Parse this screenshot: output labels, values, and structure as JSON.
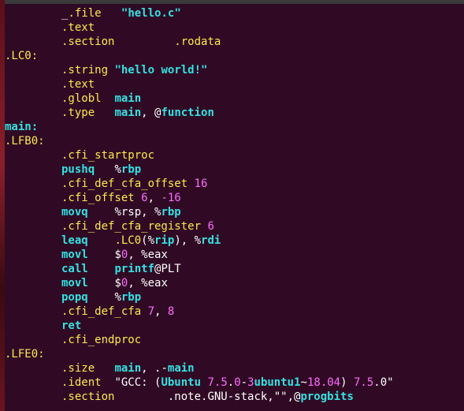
{
  "editor": {
    "lines": [
      {
        "indent": true,
        "parts": [
          {
            "text": "_",
            "c": "white"
          },
          {
            "text": ".file",
            "c": "yel"
          },
          {
            "text": "   ",
            "c": "white"
          },
          {
            "text": "\"hello.c\"",
            "c": "str"
          }
        ]
      },
      {
        "indent": true,
        "parts": [
          {
            "text": ".text",
            "c": "yel"
          }
        ]
      },
      {
        "indent": true,
        "parts": [
          {
            "text": ".section",
            "c": "yel"
          },
          {
            "text": "         ",
            "c": "white"
          },
          {
            "text": ".rodata",
            "c": "yel"
          }
        ]
      },
      {
        "indent": false,
        "parts": [
          {
            "text": ".LC0:",
            "c": "yel"
          }
        ]
      },
      {
        "indent": true,
        "parts": [
          {
            "text": ".string",
            "c": "yel"
          },
          {
            "text": " ",
            "c": "white"
          },
          {
            "text": "\"hello world!\"",
            "c": "str"
          }
        ]
      },
      {
        "indent": true,
        "parts": [
          {
            "text": ".text",
            "c": "yel"
          }
        ]
      },
      {
        "indent": true,
        "parts": [
          {
            "text": ".globl",
            "c": "yel"
          },
          {
            "text": "  ",
            "c": "white"
          },
          {
            "text": "main",
            "c": "str"
          }
        ]
      },
      {
        "indent": true,
        "parts": [
          {
            "text": ".type",
            "c": "yel"
          },
          {
            "text": "   ",
            "c": "white"
          },
          {
            "text": "main",
            "c": "str"
          },
          {
            "text": ", @",
            "c": "white"
          },
          {
            "text": "function",
            "c": "str"
          }
        ]
      },
      {
        "indent": false,
        "parts": [
          {
            "text": "main:",
            "c": "str"
          }
        ]
      },
      {
        "indent": false,
        "parts": [
          {
            "text": ".LFB0:",
            "c": "yel"
          }
        ]
      },
      {
        "indent": true,
        "parts": [
          {
            "text": ".cfi_startproc",
            "c": "yel"
          }
        ]
      },
      {
        "indent": true,
        "parts": [
          {
            "text": "pushq",
            "c": "str"
          },
          {
            "text": "   ",
            "c": "white"
          },
          {
            "text": "%",
            "c": "white"
          },
          {
            "text": "rbp",
            "c": "str"
          }
        ]
      },
      {
        "indent": true,
        "parts": [
          {
            "text": ".cfi_def_cfa_offset",
            "c": "yel"
          },
          {
            "text": " ",
            "c": "white"
          },
          {
            "text": "16",
            "c": "mag"
          }
        ]
      },
      {
        "indent": true,
        "parts": [
          {
            "text": ".cfi_offset",
            "c": "yel"
          },
          {
            "text": " ",
            "c": "white"
          },
          {
            "text": "6",
            "c": "mag"
          },
          {
            "text": ", ",
            "c": "white"
          },
          {
            "text": "-16",
            "c": "mag"
          }
        ]
      },
      {
        "indent": true,
        "parts": [
          {
            "text": "movq",
            "c": "str"
          },
          {
            "text": "    ",
            "c": "white"
          },
          {
            "text": "%rsp, %",
            "c": "white"
          },
          {
            "text": "rbp",
            "c": "str"
          }
        ]
      },
      {
        "indent": true,
        "parts": [
          {
            "text": ".cfi_def_cfa_register",
            "c": "yel"
          },
          {
            "text": " ",
            "c": "white"
          },
          {
            "text": "6",
            "c": "mag"
          }
        ]
      },
      {
        "indent": true,
        "parts": [
          {
            "text": "leaq",
            "c": "str"
          },
          {
            "text": "    ",
            "c": "white"
          },
          {
            "text": ".LC0",
            "c": "yel"
          },
          {
            "text": "(%",
            "c": "white"
          },
          {
            "text": "rip",
            "c": "str"
          },
          {
            "text": "), %",
            "c": "white"
          },
          {
            "text": "rdi",
            "c": "str"
          }
        ]
      },
      {
        "indent": true,
        "parts": [
          {
            "text": "movl",
            "c": "str"
          },
          {
            "text": "    ",
            "c": "white"
          },
          {
            "text": "$",
            "c": "white"
          },
          {
            "text": "0",
            "c": "mag"
          },
          {
            "text": ", %eax",
            "c": "white"
          }
        ]
      },
      {
        "indent": true,
        "parts": [
          {
            "text": "call",
            "c": "str"
          },
          {
            "text": "    ",
            "c": "white"
          },
          {
            "text": "printf",
            "c": "str"
          },
          {
            "text": "@PLT",
            "c": "white"
          }
        ]
      },
      {
        "indent": true,
        "parts": [
          {
            "text": "movl",
            "c": "str"
          },
          {
            "text": "    ",
            "c": "white"
          },
          {
            "text": "$",
            "c": "white"
          },
          {
            "text": "0",
            "c": "mag"
          },
          {
            "text": ", %eax",
            "c": "white"
          }
        ]
      },
      {
        "indent": true,
        "parts": [
          {
            "text": "popq",
            "c": "str"
          },
          {
            "text": "    ",
            "c": "white"
          },
          {
            "text": "%",
            "c": "white"
          },
          {
            "text": "rbp",
            "c": "str"
          }
        ]
      },
      {
        "indent": true,
        "parts": [
          {
            "text": ".cfi_def_cfa",
            "c": "yel"
          },
          {
            "text": " ",
            "c": "white"
          },
          {
            "text": "7",
            "c": "mag"
          },
          {
            "text": ", ",
            "c": "white"
          },
          {
            "text": "8",
            "c": "mag"
          }
        ]
      },
      {
        "indent": true,
        "parts": [
          {
            "text": "ret",
            "c": "str"
          }
        ]
      },
      {
        "indent": true,
        "parts": [
          {
            "text": ".cfi_endproc",
            "c": "yel"
          }
        ]
      },
      {
        "indent": false,
        "parts": [
          {
            "text": ".LFE0:",
            "c": "yel"
          }
        ]
      },
      {
        "indent": true,
        "parts": [
          {
            "text": ".size",
            "c": "yel"
          },
          {
            "text": "   ",
            "c": "white"
          },
          {
            "text": "main",
            "c": "str"
          },
          {
            "text": ", .-",
            "c": "white"
          },
          {
            "text": "main",
            "c": "str"
          }
        ]
      },
      {
        "indent": true,
        "parts": [
          {
            "text": ".ident",
            "c": "yel"
          },
          {
            "text": "  ",
            "c": "white"
          },
          {
            "text": "\"GCC: (",
            "c": "white"
          },
          {
            "text": "Ubuntu",
            "c": "str"
          },
          {
            "text": " ",
            "c": "white"
          },
          {
            "text": "7.5",
            "c": "mag"
          },
          {
            "text": ".",
            "c": "white"
          },
          {
            "text": "0",
            "c": "mag"
          },
          {
            "text": "-",
            "c": "white"
          },
          {
            "text": "3",
            "c": "mag"
          },
          {
            "text": "ubuntu1",
            "c": "str"
          },
          {
            "text": "~",
            "c": "white"
          },
          {
            "text": "18.04",
            "c": "mag"
          },
          {
            "text": ") ",
            "c": "white"
          },
          {
            "text": "7.5",
            "c": "mag"
          },
          {
            "text": ".0\"",
            "c": "white"
          }
        ]
      },
      {
        "indent": true,
        "parts": [
          {
            "text": ".section",
            "c": "yel"
          },
          {
            "text": "        ",
            "c": "white"
          },
          {
            "text": ".note.GNU-stack,\"\",@",
            "c": "white"
          },
          {
            "text": "progbits",
            "c": "str"
          }
        ]
      }
    ]
  },
  "colors": {
    "background": "#300a24",
    "yel": "#fce94f",
    "str": "#34e2e2",
    "mag": "#ff6bff",
    "white": "#ffffff"
  }
}
